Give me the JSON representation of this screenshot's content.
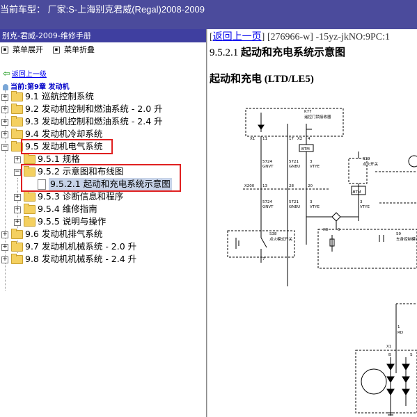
{
  "window": {
    "title": "当前车型：  厂家:S-上海别克君威(Regal)2008-2009"
  },
  "left_panel": {
    "header": "别克-君威-2009-维修手册",
    "toolbar": {
      "expand_label": "菜单展开",
      "collapse_label": "菜单折叠"
    },
    "back_link": "返回上一级",
    "current": "当前:第9章 发动机",
    "tree": [
      {
        "label": "9.1 巡航控制系统"
      },
      {
        "label": "9.2 发动机控制和燃油系统 - 2.0 升"
      },
      {
        "label": "9.3 发动机控制和燃油系统 - 2.4 升"
      },
      {
        "label": "9.4 发动机冷却系统"
      },
      {
        "label": "9.5 发动机电气系统"
      },
      {
        "label": "9.5.1 规格"
      },
      {
        "label": "9.5.2 示意图和布线图"
      },
      {
        "label": "9.5.2.1 起动和充电系统示意图"
      },
      {
        "label": "9.5.3 诊断信息和程序"
      },
      {
        "label": "9.5.4 维修指南"
      },
      {
        "label": "9.5.5 说明与操作"
      },
      {
        "label": "9.6 发动机排气系统"
      },
      {
        "label": "9.7 发动机机械系统 - 2.0 升"
      },
      {
        "label": "9.8 发动机机械系统 - 2.4 升"
      }
    ]
  },
  "content": {
    "back_link": "返回上一页",
    "doc_code": "[276966-w] -15yz-jkNO:9PC:1",
    "section_number": "9.5.2.1",
    "section_title": "起动和充电系统示意图",
    "subtitle": "起动和充电 (LTD/LE5)",
    "diagram_labels": {
      "k77": "K77",
      "k77_desc": "遥控门锁接收器",
      "x1": "X1",
      "x2": "X2",
      "p11": "11",
      "p17": "17",
      "p4": "4",
      "btm": "BTM",
      "w1a": "5724",
      "w1b": "GNVT",
      "w2a": "5721",
      "w2b": "GNBU",
      "w3a": "3",
      "w3b": "VTYE",
      "s39": "S39",
      "s39_desc": "点火开关",
      "x200": "X200",
      "n13": "13",
      "n28": "28",
      "n20": "20",
      "neg_btm": "-BTM",
      "s38": "S38",
      "s38_desc": "点火模式开关",
      "x3": "X3",
      "n6": "6",
      "s9": "S9",
      "s9_desc": "车身控制模块",
      "n7": "7",
      "n1": "1",
      "rd": "RD",
      "x1b": "X1",
      "b": "B",
      "s": "S"
    }
  }
}
